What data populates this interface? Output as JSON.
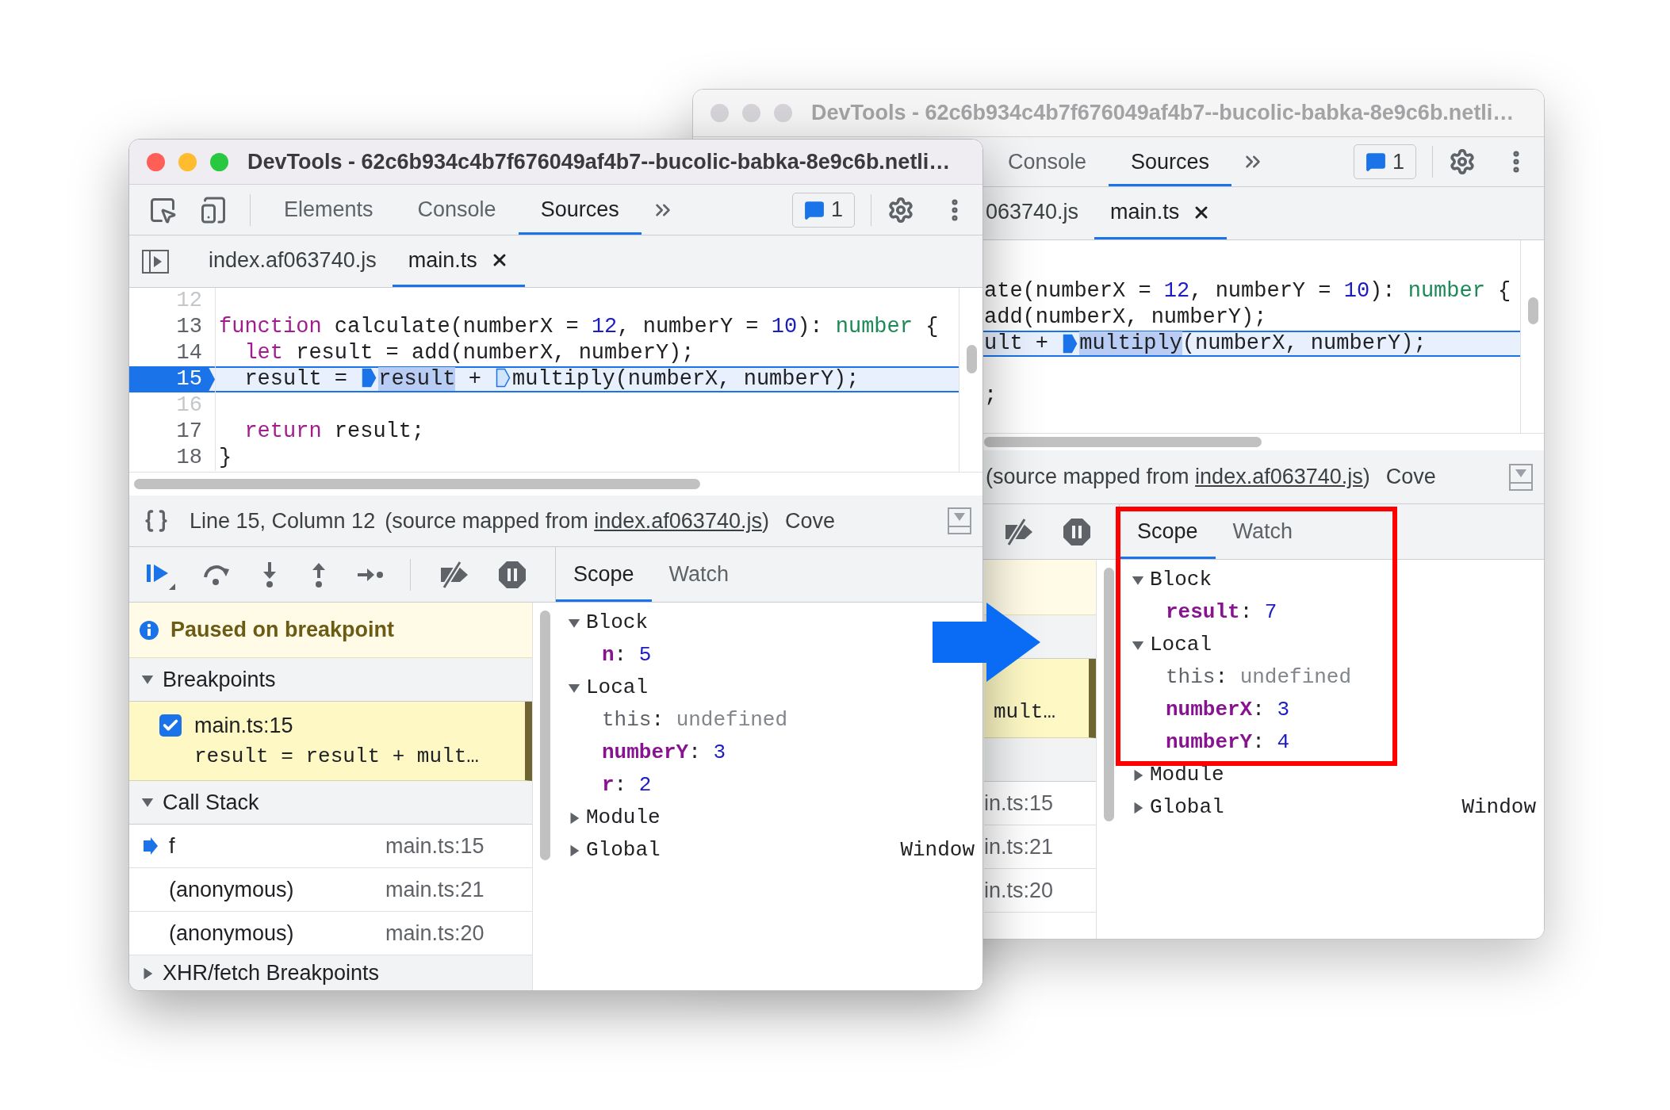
{
  "back_window": {
    "title": "DevTools - 62c6b934c4b7f676049af4b7--bucolic-babka-8e9c6b.netli…",
    "active": false,
    "tabs": [
      {
        "label": "Console",
        "selected": false
      },
      {
        "label": "Sources",
        "selected": true
      }
    ],
    "issues_count": "1",
    "file_tabs": [
      {
        "label": "063740.js",
        "selected": false,
        "closable": false
      },
      {
        "label": "main.ts",
        "selected": true,
        "closable": true
      }
    ],
    "code_lines": [
      {
        "current": false
      },
      {
        "current": false,
        "tokens": [
          {
            "kind": "plain",
            "text": "ate(numberX = "
          },
          {
            "kind": "number",
            "text": "12"
          },
          {
            "kind": "plain",
            "text": ", numberY = "
          },
          {
            "kind": "number",
            "text": "10"
          },
          {
            "kind": "plain",
            "text": "): "
          },
          {
            "kind": "type",
            "text": "number"
          },
          {
            "kind": "plain",
            "text": " {"
          }
        ]
      },
      {
        "current": false,
        "tokens": [
          {
            "kind": "plain",
            "text": "add(numberX, numberY);"
          }
        ]
      },
      {
        "current": true,
        "tokens": [
          {
            "kind": "plain",
            "text": "ult + "
          },
          {
            "kind": "marker",
            "active": true
          },
          {
            "kind": "highlighted",
            "text": "multiply"
          },
          {
            "kind": "plain",
            "text": "(numberX, numberY);"
          }
        ]
      },
      {
        "current": false
      },
      {
        "current": false,
        "tokens": [
          {
            "kind": "plain",
            "text": ";"
          }
        ]
      }
    ],
    "status": {
      "prefix": "(source mapped from ",
      "link": "index.af063740.js",
      "suffix": ")",
      "coverage": "Cove"
    },
    "breakpoint_snippet": "mult…",
    "call_stack_locations": [
      "in.ts:15",
      "in.ts:21",
      "in.ts:20"
    ],
    "scope_tabs": [
      {
        "label": "Scope",
        "selected": true
      },
      {
        "label": "Watch",
        "selected": false
      }
    ],
    "scopes": [
      {
        "name": "Block",
        "expanded": true,
        "vars": [
          {
            "name": "result",
            "separator": ":",
            "value": "7",
            "kind": "variable"
          }
        ]
      },
      {
        "name": "Local",
        "expanded": true,
        "vars": [
          {
            "name": "this",
            "separator": ":",
            "value": "undefined",
            "kind": "receiver"
          },
          {
            "name": "numberX",
            "separator": ":",
            "value": "3",
            "kind": "variable"
          },
          {
            "name": "numberY",
            "separator": ":",
            "value": "4",
            "kind": "variable"
          }
        ]
      },
      {
        "name": "Module",
        "expanded": false
      },
      {
        "name": "Global",
        "expanded": false,
        "value": "Window"
      }
    ]
  },
  "front_window": {
    "title": "DevTools - 62c6b934c4b7f676049af4b7--bucolic-babka-8e9c6b.netli…",
    "active": true,
    "tabs": [
      {
        "label": "Elements",
        "selected": false
      },
      {
        "label": "Console",
        "selected": false
      },
      {
        "label": "Sources",
        "selected": true
      }
    ],
    "issues_count": "1",
    "file_tabs": [
      {
        "label": "index.af063740.js",
        "selected": false,
        "closable": false
      },
      {
        "label": "main.ts",
        "selected": true,
        "closable": true
      }
    ],
    "code_lines": [
      {
        "number": "12",
        "executable": false,
        "current": false
      },
      {
        "number": "13",
        "executable": true,
        "current": false,
        "indented": false,
        "tokens": [
          {
            "kind": "keyword",
            "text": "function"
          },
          {
            "kind": "plain",
            "text": " calculate(numberX = "
          },
          {
            "kind": "number",
            "text": "12"
          },
          {
            "kind": "plain",
            "text": ", numberY = "
          },
          {
            "kind": "number",
            "text": "10"
          },
          {
            "kind": "plain",
            "text": "): "
          },
          {
            "kind": "type",
            "text": "number"
          },
          {
            "kind": "plain",
            "text": " {"
          }
        ]
      },
      {
        "number": "14",
        "executable": true,
        "current": false,
        "indented": true,
        "tokens": [
          {
            "kind": "keyword",
            "text": "let"
          },
          {
            "kind": "plain",
            "text": " result = add(numberX, numberY);"
          }
        ]
      },
      {
        "number": "15",
        "executable": true,
        "current": true,
        "indented": true,
        "tokens": [
          {
            "kind": "plain",
            "text": "result = "
          },
          {
            "kind": "marker",
            "active": true
          },
          {
            "kind": "highlighted",
            "text": "result"
          },
          {
            "kind": "plain",
            "text": " + "
          },
          {
            "kind": "marker",
            "active": false
          },
          {
            "kind": "plain",
            "text": "multiply(numberX, numberY);"
          }
        ]
      },
      {
        "number": "16",
        "executable": false,
        "current": false
      },
      {
        "number": "17",
        "executable": true,
        "current": false,
        "indented": true,
        "tokens": [
          {
            "kind": "keyword",
            "text": "return"
          },
          {
            "kind": "plain",
            "text": " result;"
          }
        ]
      },
      {
        "number": "18",
        "executable": true,
        "current": false,
        "indented": false,
        "tokens": [
          {
            "kind": "plain",
            "text": "}"
          }
        ]
      }
    ],
    "status": {
      "position": "Line 15, Column 12",
      "prefix": "(source mapped from ",
      "link": "index.af063740.js",
      "suffix": ")",
      "coverage": "Cove"
    },
    "paused_message": "Paused on breakpoint",
    "breakpoints": {
      "title": "Breakpoints",
      "expanded": true,
      "items": [
        {
          "location": "main.ts:15",
          "code": "result = result + mult…",
          "checked": true
        }
      ]
    },
    "call_stack": {
      "title": "Call Stack",
      "expanded": true,
      "frames": [
        {
          "name": "f",
          "location": "main.ts:15",
          "current": true
        },
        {
          "name": "(anonymous)",
          "location": "main.ts:21",
          "current": false
        },
        {
          "name": "(anonymous)",
          "location": "main.ts:20",
          "current": false
        }
      ]
    },
    "xhr_breakpoints": {
      "title": "XHR/fetch Breakpoints",
      "expanded": false
    },
    "scope_tabs": [
      {
        "label": "Scope",
        "selected": true
      },
      {
        "label": "Watch",
        "selected": false
      }
    ],
    "scopes": [
      {
        "name": "Block",
        "expanded": true,
        "vars": [
          {
            "name": "n",
            "separator": ":",
            "value": "5",
            "kind": "variable"
          }
        ]
      },
      {
        "name": "Local",
        "expanded": true,
        "vars": [
          {
            "name": "this",
            "separator": ":",
            "value": "undefined",
            "kind": "receiver"
          },
          {
            "name": "numberY",
            "separator": ":",
            "value": "3",
            "kind": "variable"
          },
          {
            "name": "r",
            "separator": ":",
            "value": "2",
            "kind": "variable"
          }
        ]
      },
      {
        "name": "Module",
        "expanded": false
      },
      {
        "name": "Global",
        "expanded": false,
        "value": "Window"
      }
    ]
  }
}
